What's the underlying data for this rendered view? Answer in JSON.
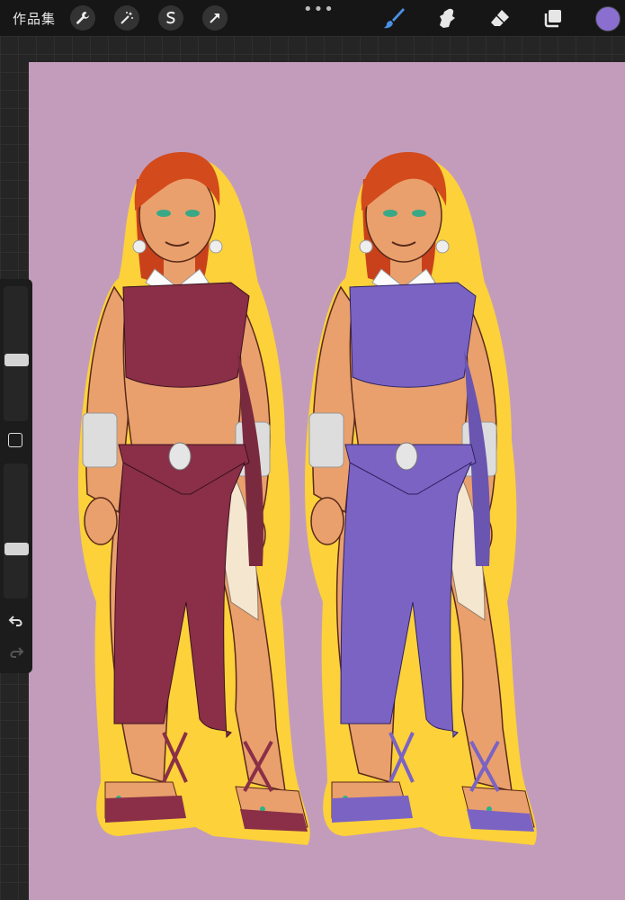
{
  "toolbar": {
    "gallery_label": "作品集",
    "left_tools": [
      "wrench-icon",
      "magic-wand-icon",
      "selection-s-icon",
      "transform-arrow-icon"
    ],
    "more_label": "•••",
    "right_tools": [
      "brush-icon",
      "smudge-icon",
      "eraser-icon",
      "layers-icon"
    ],
    "current_color": "#8a6fd0",
    "brush_color": "#4a90e2"
  },
  "sidebar": {
    "brush_size_level": 0.45,
    "opacity_level": 0.35
  },
  "canvas": {
    "background_color": "#c39cbb",
    "sticker_outline_color": "#fcd13a",
    "figures": [
      {
        "name": "maroon-outfit-figure",
        "outfit_color": "#8a2f47"
      },
      {
        "name": "purple-outfit-figure",
        "outfit_color": "#7b63c4"
      }
    ]
  }
}
